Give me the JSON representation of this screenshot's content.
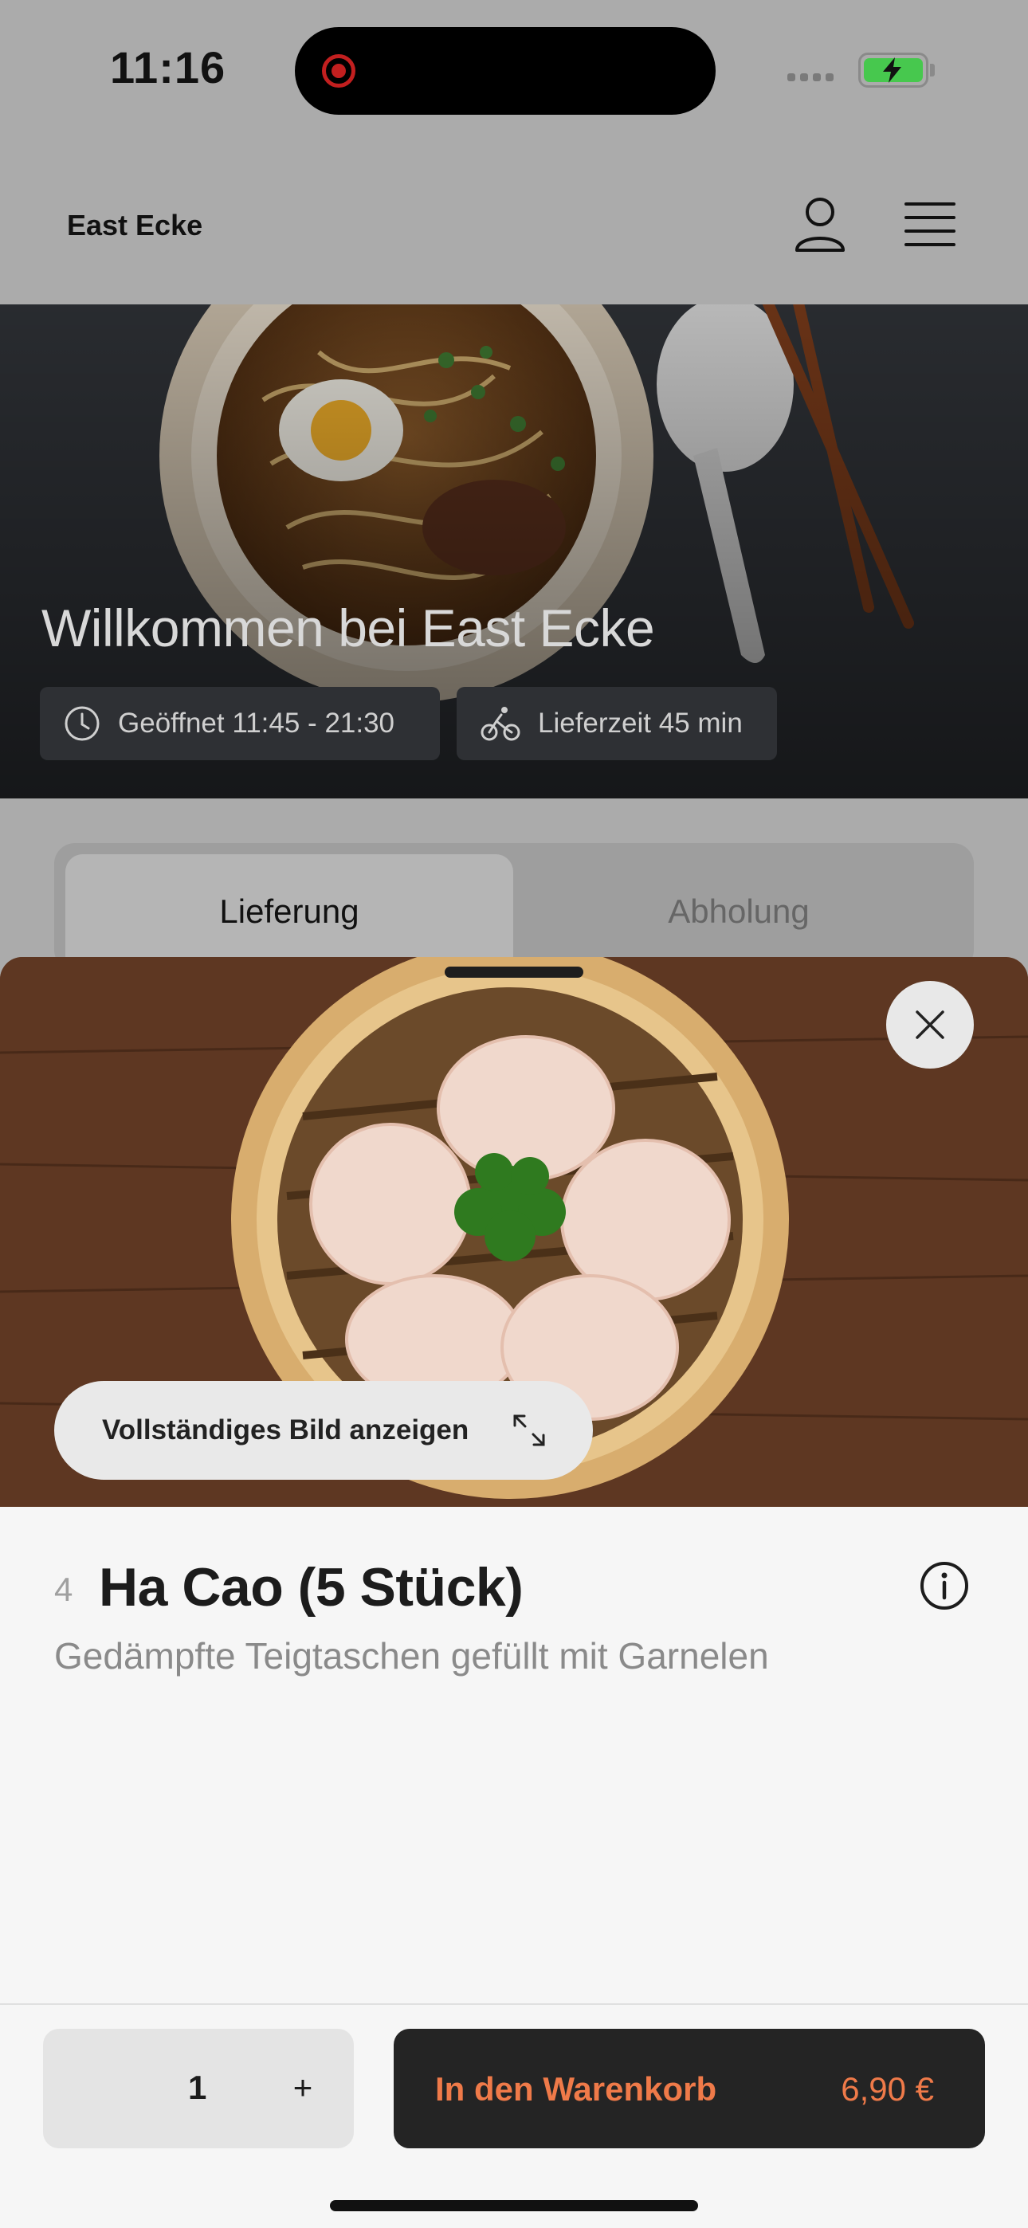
{
  "status_bar": {
    "time": "11:16"
  },
  "header": {
    "brand": "East Ecke"
  },
  "hero": {
    "title": "Willkommen bei East Ecke",
    "opening_hours": "Geöffnet 11:45 - 21:30",
    "delivery_time": "Lieferzeit 45 min"
  },
  "tabs": [
    {
      "label": "Lieferung",
      "active": true
    },
    {
      "label": "Abholung",
      "active": false
    }
  ],
  "product": {
    "view_image_label": "Vollständiges Bild anzeigen",
    "number": "4",
    "name": "Ha Cao (5 Stück)",
    "description": "Gedämpfte Teigtaschen gefüllt mit Garnelen"
  },
  "order": {
    "quantity": "1",
    "plus": "+",
    "add_to_cart_label": "In den Warenkorb",
    "price": "6,90 €"
  },
  "colors": {
    "accent": "#ef7a49",
    "dark": "#242424",
    "battery": "#47c84e",
    "record": "#c21f1f"
  },
  "icons": [
    "record-icon",
    "signal-icon",
    "battery-icon",
    "user-icon",
    "menu-icon",
    "clock-icon",
    "bike-icon",
    "close-icon",
    "expand-icon",
    "info-icon"
  ]
}
